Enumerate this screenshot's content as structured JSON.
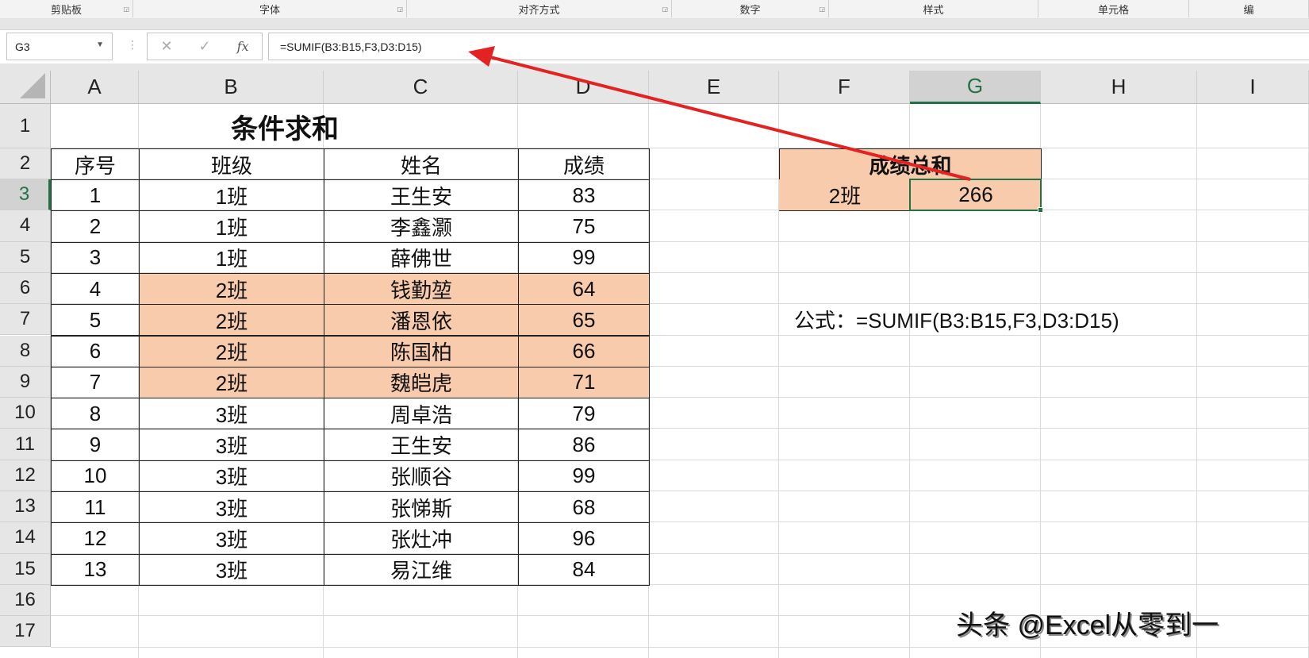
{
  "ribbon": {
    "groups": [
      "剪贴板",
      "字体",
      "对齐方式",
      "数字",
      "样式",
      "单元格",
      "编"
    ]
  },
  "formula_bar": {
    "name_box": "G3",
    "cancel": "✕",
    "enter": "✓",
    "fx": "fx",
    "formula": "=SUMIF(B3:B15,F3,D3:D15)"
  },
  "columns": [
    "A",
    "B",
    "C",
    "D",
    "E",
    "F",
    "G",
    "H",
    "I"
  ],
  "rows": [
    "1",
    "2",
    "3",
    "4",
    "5",
    "6",
    "7",
    "8",
    "9",
    "10",
    "11",
    "12",
    "13",
    "14",
    "15",
    "16",
    "17"
  ],
  "selected_cell": "G3",
  "fill_color": "#f8cbad",
  "accent_color": "#217346",
  "sheet": {
    "title": "条件求和",
    "headers": [
      "序号",
      "班级",
      "姓名",
      "成绩"
    ],
    "records": [
      [
        "1",
        "1班",
        "王生安",
        "83"
      ],
      [
        "2",
        "1班",
        "李鑫灏",
        "75"
      ],
      [
        "3",
        "1班",
        "薛佛世",
        "99"
      ],
      [
        "4",
        "2班",
        "钱勤堃",
        "64"
      ],
      [
        "5",
        "2班",
        "潘恩依",
        "65"
      ],
      [
        "6",
        "2班",
        "陈国柏",
        "66"
      ],
      [
        "7",
        "2班",
        "魏皑虎",
        "71"
      ],
      [
        "8",
        "3班",
        "周卓浩",
        "79"
      ],
      [
        "9",
        "3班",
        "王生安",
        "86"
      ],
      [
        "10",
        "3班",
        "张顺谷",
        "99"
      ],
      [
        "11",
        "3班",
        "张悌斯",
        "68"
      ],
      [
        "12",
        "3班",
        "张灶冲",
        "96"
      ],
      [
        "13",
        "3班",
        "易江维",
        "84"
      ]
    ],
    "summary": {
      "header": "成绩总和",
      "criteria": "2班",
      "result": "266"
    },
    "note": "公式：=SUMIF(B3:B15,F3,D3:D15)"
  },
  "watermark": "头条 @Excel从零到一"
}
